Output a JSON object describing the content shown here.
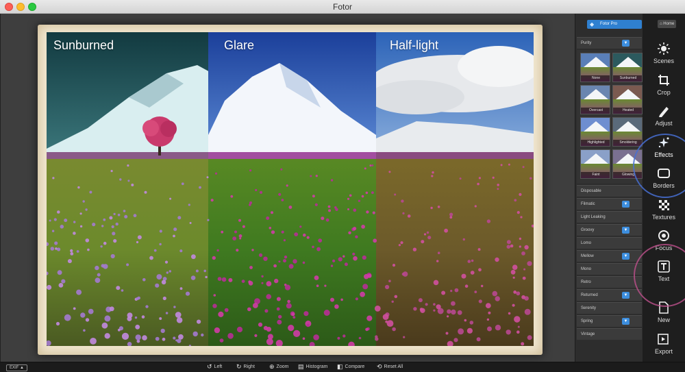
{
  "window": {
    "title": "Fotor"
  },
  "canvas": {
    "panels": [
      {
        "label": "Sunburned"
      },
      {
        "label": "Glare"
      },
      {
        "label": "Half-light"
      }
    ]
  },
  "bottom_toolbar": {
    "exif": "EXIF ▲",
    "items": [
      {
        "label": "Left",
        "icon": "rotate-left-icon"
      },
      {
        "label": "Right",
        "icon": "rotate-right-icon"
      },
      {
        "label": "Zoom",
        "icon": "zoom-icon"
      },
      {
        "label": "Histogram",
        "icon": "histogram-icon"
      },
      {
        "label": "Compare",
        "icon": "compare-icon"
      },
      {
        "label": "Reset All",
        "icon": "reset-icon"
      }
    ]
  },
  "effects_panel": {
    "pro_label": "Fotor Pro",
    "categories_top": [
      {
        "label": "Purity"
      }
    ],
    "thumbnails": [
      {
        "label": "None"
      },
      {
        "label": "Sunburned"
      },
      {
        "label": "Overcast"
      },
      {
        "label": "Heated"
      },
      {
        "label": "Highlighted"
      },
      {
        "label": "Smoldering"
      },
      {
        "label": "Faint"
      },
      {
        "label": "Glowing"
      }
    ],
    "categories": [
      {
        "label": "Disposable",
        "dropdown": false
      },
      {
        "label": "Filmatic",
        "dropdown": true
      },
      {
        "label": "Light Leaking",
        "dropdown": false
      },
      {
        "label": "Groovy",
        "dropdown": true
      },
      {
        "label": "Lomo",
        "dropdown": false
      },
      {
        "label": "Mellow",
        "dropdown": true
      },
      {
        "label": "Mono",
        "dropdown": false
      },
      {
        "label": "Retro",
        "dropdown": false
      },
      {
        "label": "Returned",
        "dropdown": true
      },
      {
        "label": "Serenity",
        "dropdown": false
      },
      {
        "label": "Spring",
        "dropdown": true
      },
      {
        "label": "Vintage",
        "dropdown": false
      }
    ]
  },
  "tools": {
    "home_label": "Home",
    "items": [
      {
        "label": "Scenes",
        "icon": "sun-icon"
      },
      {
        "label": "Crop",
        "icon": "crop-icon"
      },
      {
        "label": "Adjust",
        "icon": "pencil-icon"
      },
      {
        "label": "Effects",
        "icon": "sparkle-icon",
        "active": true
      },
      {
        "label": "Borders",
        "icon": "border-icon"
      },
      {
        "label": "Textures",
        "icon": "checker-icon"
      },
      {
        "label": "Focus",
        "icon": "focus-icon"
      },
      {
        "label": "Text",
        "icon": "text-icon"
      },
      {
        "label": "New",
        "icon": "new-document-icon"
      },
      {
        "label": "Export",
        "icon": "export-icon"
      }
    ]
  },
  "colors": {
    "accent": "#2f80d0",
    "highlight_blue": "#3f6fd0",
    "highlight_pink": "#c0508a"
  }
}
